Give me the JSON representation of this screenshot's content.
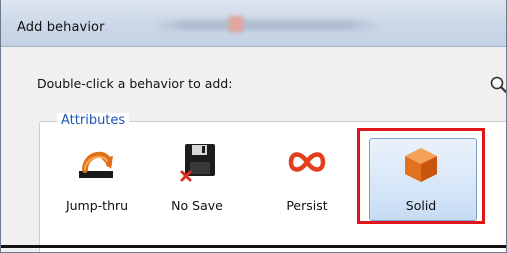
{
  "window": {
    "title": "Add behavior"
  },
  "prompt": "Double-click a behavior to add:",
  "group": {
    "legend": "Attributes",
    "items": [
      {
        "label": "Jump-thru",
        "icon": "jump-thru-icon"
      },
      {
        "label": "No Save",
        "icon": "floppy-disk-no-save-icon"
      },
      {
        "label": "Persist",
        "icon": "infinity-icon"
      },
      {
        "label": "Solid",
        "icon": "orange-cube-icon",
        "selected": true
      }
    ]
  },
  "colors": {
    "legend": "#1f56b6",
    "highlight": "#e0141c",
    "selection": "#d6e6f8"
  }
}
